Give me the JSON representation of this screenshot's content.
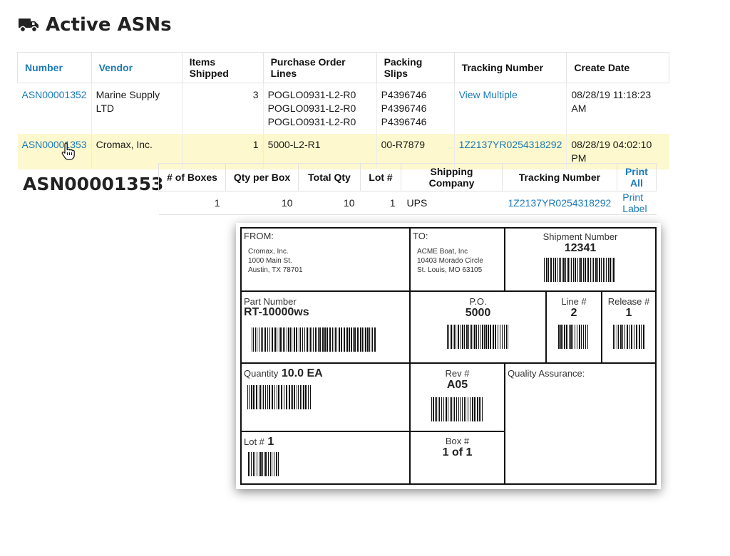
{
  "page": {
    "title": "Active ASNs",
    "title_icon": "truck-icon"
  },
  "asn_table": {
    "headers": [
      "Number",
      "Vendor",
      "Items Shipped",
      "Purchase Order Lines",
      "Packing Slips",
      "Tracking Number",
      "Create Date"
    ],
    "rows": [
      {
        "number": "ASN00001352",
        "vendor": "Marine Supply LTD",
        "items_shipped": "3",
        "po_lines": [
          "POGLO0931-L2-R0",
          "POGLO0931-L2-R0",
          "POGLO0931-L2-R0"
        ],
        "packing_slips": [
          "P4396746",
          "P4396746",
          "P4396746"
        ],
        "tracking": "View Multiple",
        "create_date": "08/28/19 11:18:23 AM"
      },
      {
        "number": "ASN00001353",
        "vendor": "Cromax, Inc.",
        "items_shipped": "1",
        "po_lines": [
          "5000-L2-R1"
        ],
        "packing_slips": [
          "00-R7879"
        ],
        "tracking": "1Z2137YR0254318292",
        "create_date": "08/28/19 04:02:10 PM"
      }
    ],
    "highlight_color": "#fdf8cd",
    "link_color": "#1a7ab8"
  },
  "detail": {
    "title": "ASN00001353",
    "headers": [
      "# of Boxes",
      "Qty per Box",
      "Total Qty",
      "Lot #",
      "Shipping Company",
      "Tracking Number",
      "Print All"
    ],
    "row": {
      "boxes": "1",
      "qty_per_box": "10",
      "total_qty": "10",
      "lot": "1",
      "shipping_company": "UPS",
      "tracking": "1Z2137YR0254318292",
      "action": "Print Label"
    }
  },
  "label": {
    "from_label": "FROM:",
    "from_lines": [
      "Cromax, Inc.",
      "1000 Main St.",
      "Austin, TX 78701"
    ],
    "to_label": "TO:",
    "to_lines": [
      "ACME Boat, Inc",
      "10403 Morado Circle",
      "St. Louis, MO 63105"
    ],
    "shipment_label": "Shipment Number",
    "shipment_value": "12341",
    "part_label": "Part Number",
    "part_value": "RT-10000ws",
    "po_label": "P.O.",
    "po_value": "5000",
    "line_label": "Line #",
    "line_value": "2",
    "release_label": "Release #",
    "release_value": "1",
    "quantity_label": "Quantity",
    "quantity_value": "10.0 EA",
    "rev_label": "Rev #",
    "rev_value": "A05",
    "qa_label": "Quality Assurance:",
    "lot_label": "Lot #",
    "lot_value": "1",
    "box_label": "Box #",
    "box_value": "1 of 1"
  }
}
